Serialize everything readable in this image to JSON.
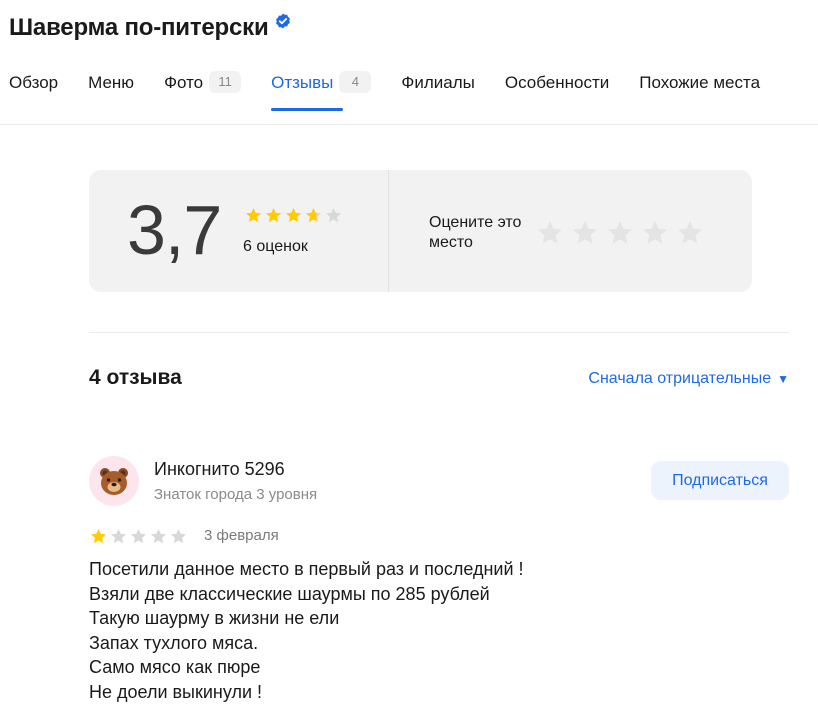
{
  "place": {
    "title": "Шаверма по-питерски"
  },
  "tabs": [
    {
      "label": "Обзор",
      "count": ""
    },
    {
      "label": "Меню",
      "count": ""
    },
    {
      "label": "Фото",
      "count": "11"
    },
    {
      "label": "Отзывы",
      "count": "4",
      "active": true
    },
    {
      "label": "Филиалы",
      "count": ""
    },
    {
      "label": "Особенности",
      "count": ""
    },
    {
      "label": "Похожие места",
      "count": ""
    }
  ],
  "rating": {
    "value": "3,7",
    "stars": 3.7,
    "count_label": "6 оценок",
    "rate_prompt": "Оцените это место"
  },
  "reviews": {
    "title": "4 отзыва",
    "sort_label": "Сначала отрицательные",
    "items": [
      {
        "author": "Инкогнито 5296",
        "level": "Знаток города 3 уровня",
        "subscribe_label": "Подписаться",
        "stars": 1,
        "date": "3 февраля",
        "lines": [
          "Посетили данное место в первый раз и последний !",
          "Взяли две классические шаурмы по 285 рублей",
          "Такую шаурму в жизни не ели",
          "Запах тухлого мяса.",
          "Само мясо как пюре",
          "Не доели выкинули !"
        ]
      }
    ]
  },
  "colors": {
    "accent": "#1e69e6",
    "star_filled": "#fc0",
    "star_empty": "#d8d8d8",
    "card_bg": "#f2f2f2"
  }
}
